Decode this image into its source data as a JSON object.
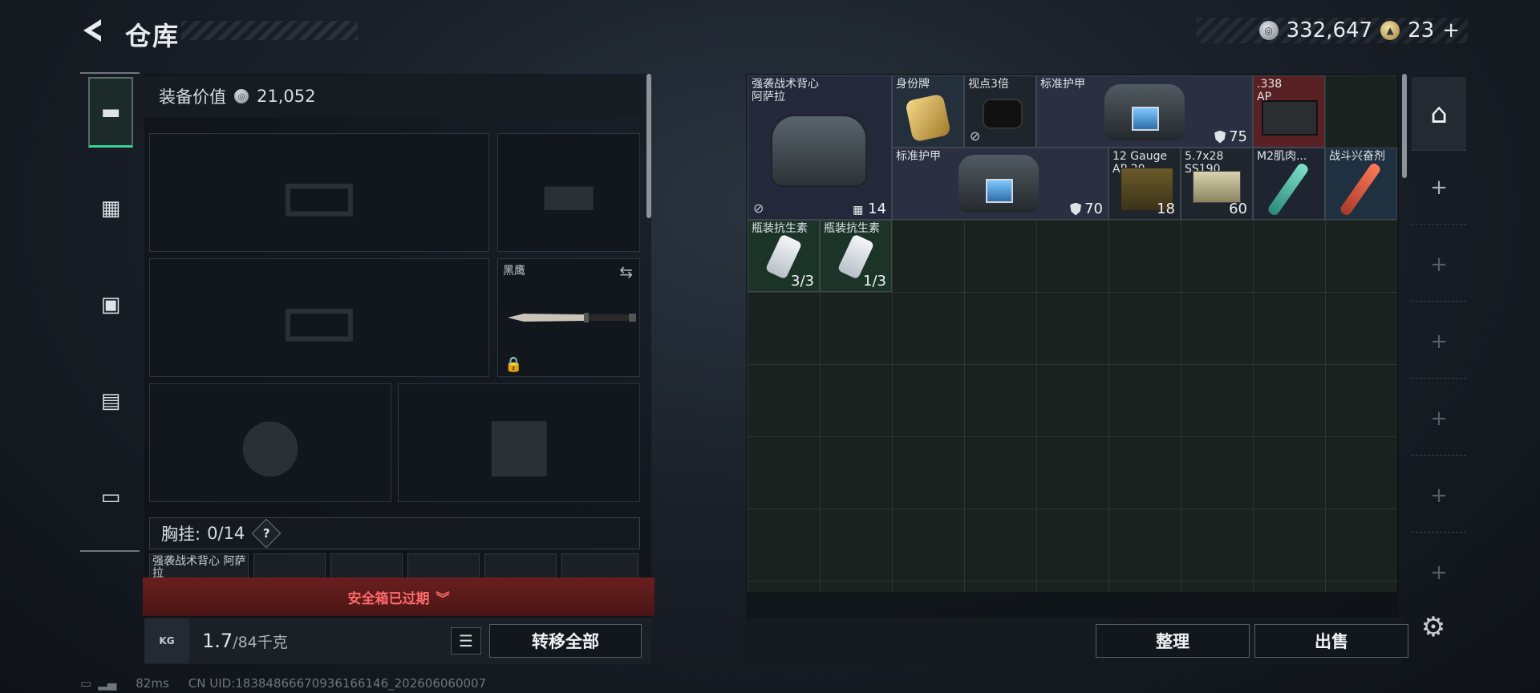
{
  "header": {
    "title": "仓库",
    "currency": [
      {
        "icon": "silver-coin-icon",
        "value": "332,647"
      },
      {
        "icon": "gold-coin-icon",
        "value": "23"
      }
    ],
    "gold_add": "+"
  },
  "equipment": {
    "label": "装备价值",
    "value": "21,052",
    "melee_name": "黑鹰",
    "chest_rig_label": "胸挂:",
    "chest_rig_count": "0",
    "chest_rig_capacity": "/14",
    "help": "?",
    "mini_slot_label": "强袭战术背心 阿萨拉"
  },
  "safe_box": {
    "text": "安全箱已过期"
  },
  "weight": {
    "current": "1.7",
    "max": "/84千克",
    "icon_text": "KG"
  },
  "buttons": {
    "transfer_all": "转移全部",
    "organize": "整理",
    "sell": "出售"
  },
  "warehouse_items": [
    {
      "name_line1": "强袭战术背心",
      "name_line2": "阿萨拉",
      "value": "14"
    },
    {
      "name": "身份牌"
    },
    {
      "name": "视点3倍"
    },
    {
      "name": "标准护甲",
      "value": "75"
    },
    {
      "name_line1": ".338",
      "name_line2": "AP"
    },
    {
      "name": "标准护甲",
      "value": "70"
    },
    {
      "name_line1": "12 Gauge",
      "name_line2": "AP-20",
      "value": "18"
    },
    {
      "name_line1": "5.7x28",
      "name_line2": "SS190",
      "value": "60"
    },
    {
      "name": "M2肌肉..."
    },
    {
      "name": "战斗兴奋剂"
    },
    {
      "name": "瓶装抗生素",
      "value": "3/3"
    },
    {
      "name": "瓶装抗生素",
      "value": "1/3"
    }
  ],
  "storage_tabs": {
    "add": "+"
  },
  "footer": {
    "ping": "82ms",
    "uid": "CN UID:18384866670936166146_202606060007"
  },
  "colors": {
    "accent_green": "#3ad19a",
    "warning_red": "#ff6a6a",
    "armor_blue": "#7fc8ff"
  }
}
